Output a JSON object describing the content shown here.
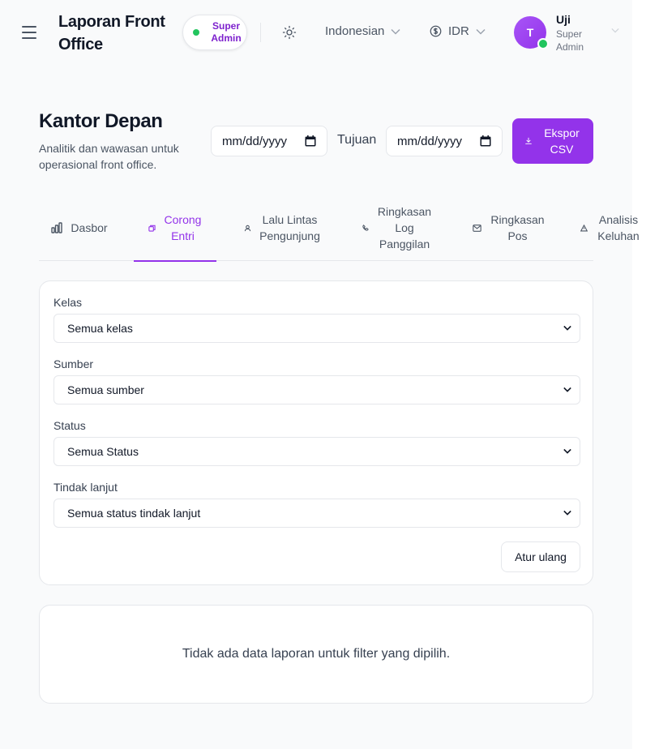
{
  "header": {
    "title": "Laporan Front Office",
    "role_badge": "Super Admin",
    "language": "Indonesian",
    "currency": "IDR",
    "user": {
      "initial": "T",
      "name": "Uji",
      "role": "Super Admin"
    }
  },
  "page": {
    "title": "Kantor Depan",
    "subtitle": "Analitik dan wawasan untuk operasional front office.",
    "date_from_placeholder": "mm/dd/yyyy",
    "date_to_label": "Tujuan",
    "date_to_placeholder": "mm/dd/yyyy",
    "export_label": "Ekspor CSV"
  },
  "tabs": [
    {
      "label": "Dasbor",
      "icon": "chart-bar-icon",
      "active": false
    },
    {
      "label": "Corong Entri",
      "icon": "funnel-icon",
      "active": true
    },
    {
      "label": "Lalu Lintas Pengunjung",
      "icon": "visitor-icon",
      "active": false
    },
    {
      "label": "Ringkasan Log Panggilan",
      "icon": "phone-icon",
      "active": false
    },
    {
      "label": "Ringkasan Pos",
      "icon": "mail-icon",
      "active": false
    },
    {
      "label": "Analisis Keluhan",
      "icon": "warning-icon",
      "active": false
    }
  ],
  "filters": {
    "class": {
      "label": "Kelas",
      "value": "Semua kelas"
    },
    "source": {
      "label": "Sumber",
      "value": "Semua sumber"
    },
    "status": {
      "label": "Status",
      "value": "Semua Status"
    },
    "followup": {
      "label": "Tindak lanjut",
      "value": "Semua status tindak lanjut"
    },
    "reset_label": "Atur ulang"
  },
  "empty_message": "Tidak ada data laporan untuk filter yang dipilih.",
  "colors": {
    "accent": "#9333ea",
    "online": "#22c55e",
    "border": "#e5e7eb"
  }
}
